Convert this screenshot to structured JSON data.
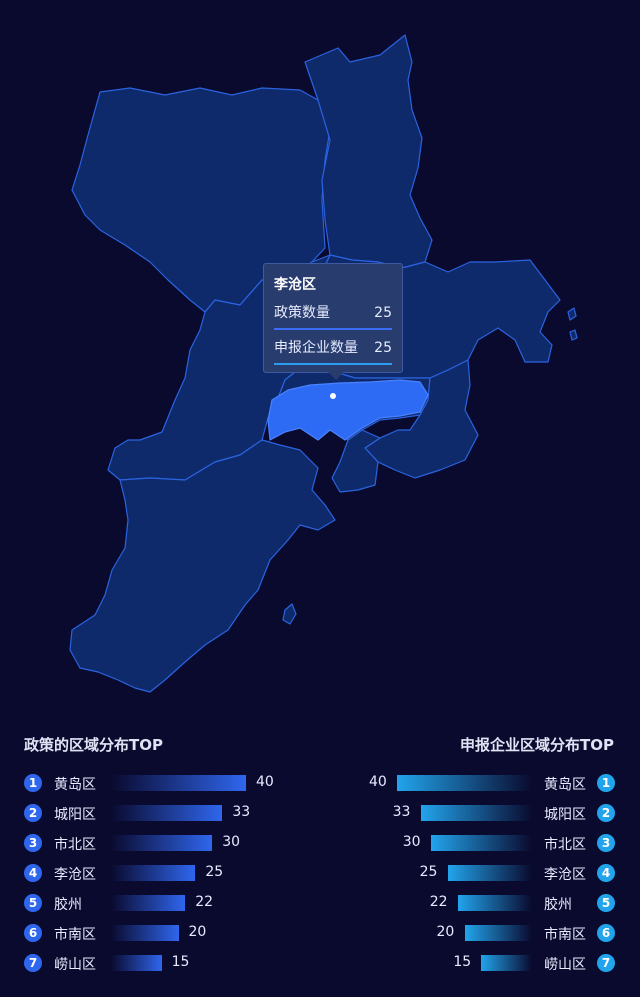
{
  "map": {
    "tooltip": {
      "title": "李沧区",
      "rows": [
        {
          "label": "政策数量",
          "value": "25"
        },
        {
          "label": "申报企业数量",
          "value": "25"
        }
      ]
    },
    "colors": {
      "region_fill": "#0f2a6b",
      "region_stroke": "#2a63e0",
      "highlight_fill": "#2e6bf5",
      "background": "#0a0a2e"
    }
  },
  "chart_data": [
    {
      "type": "bar",
      "orientation": "horizontal",
      "title": "政策的区域分布TOP",
      "ranks": [
        "1",
        "2",
        "3",
        "4",
        "5",
        "6",
        "7"
      ],
      "categories": [
        "黄岛区",
        "城阳区",
        "市北区",
        "李沧区",
        "胶州",
        "市南区",
        "崂山区"
      ],
      "values": [
        40,
        33,
        30,
        25,
        22,
        20,
        15
      ],
      "xlim": [
        0,
        40
      ],
      "color": "#2f66ee"
    },
    {
      "type": "bar",
      "orientation": "horizontal",
      "title": "申报企业区域分布TOP",
      "ranks": [
        "1",
        "2",
        "3",
        "4",
        "5",
        "6",
        "7"
      ],
      "categories": [
        "黄岛区",
        "城阳区",
        "市北区",
        "李沧区",
        "胶州",
        "市南区",
        "崂山区"
      ],
      "values": [
        40,
        33,
        30,
        25,
        22,
        20,
        15
      ],
      "xlim": [
        0,
        40
      ],
      "color": "#22a4ec"
    }
  ]
}
